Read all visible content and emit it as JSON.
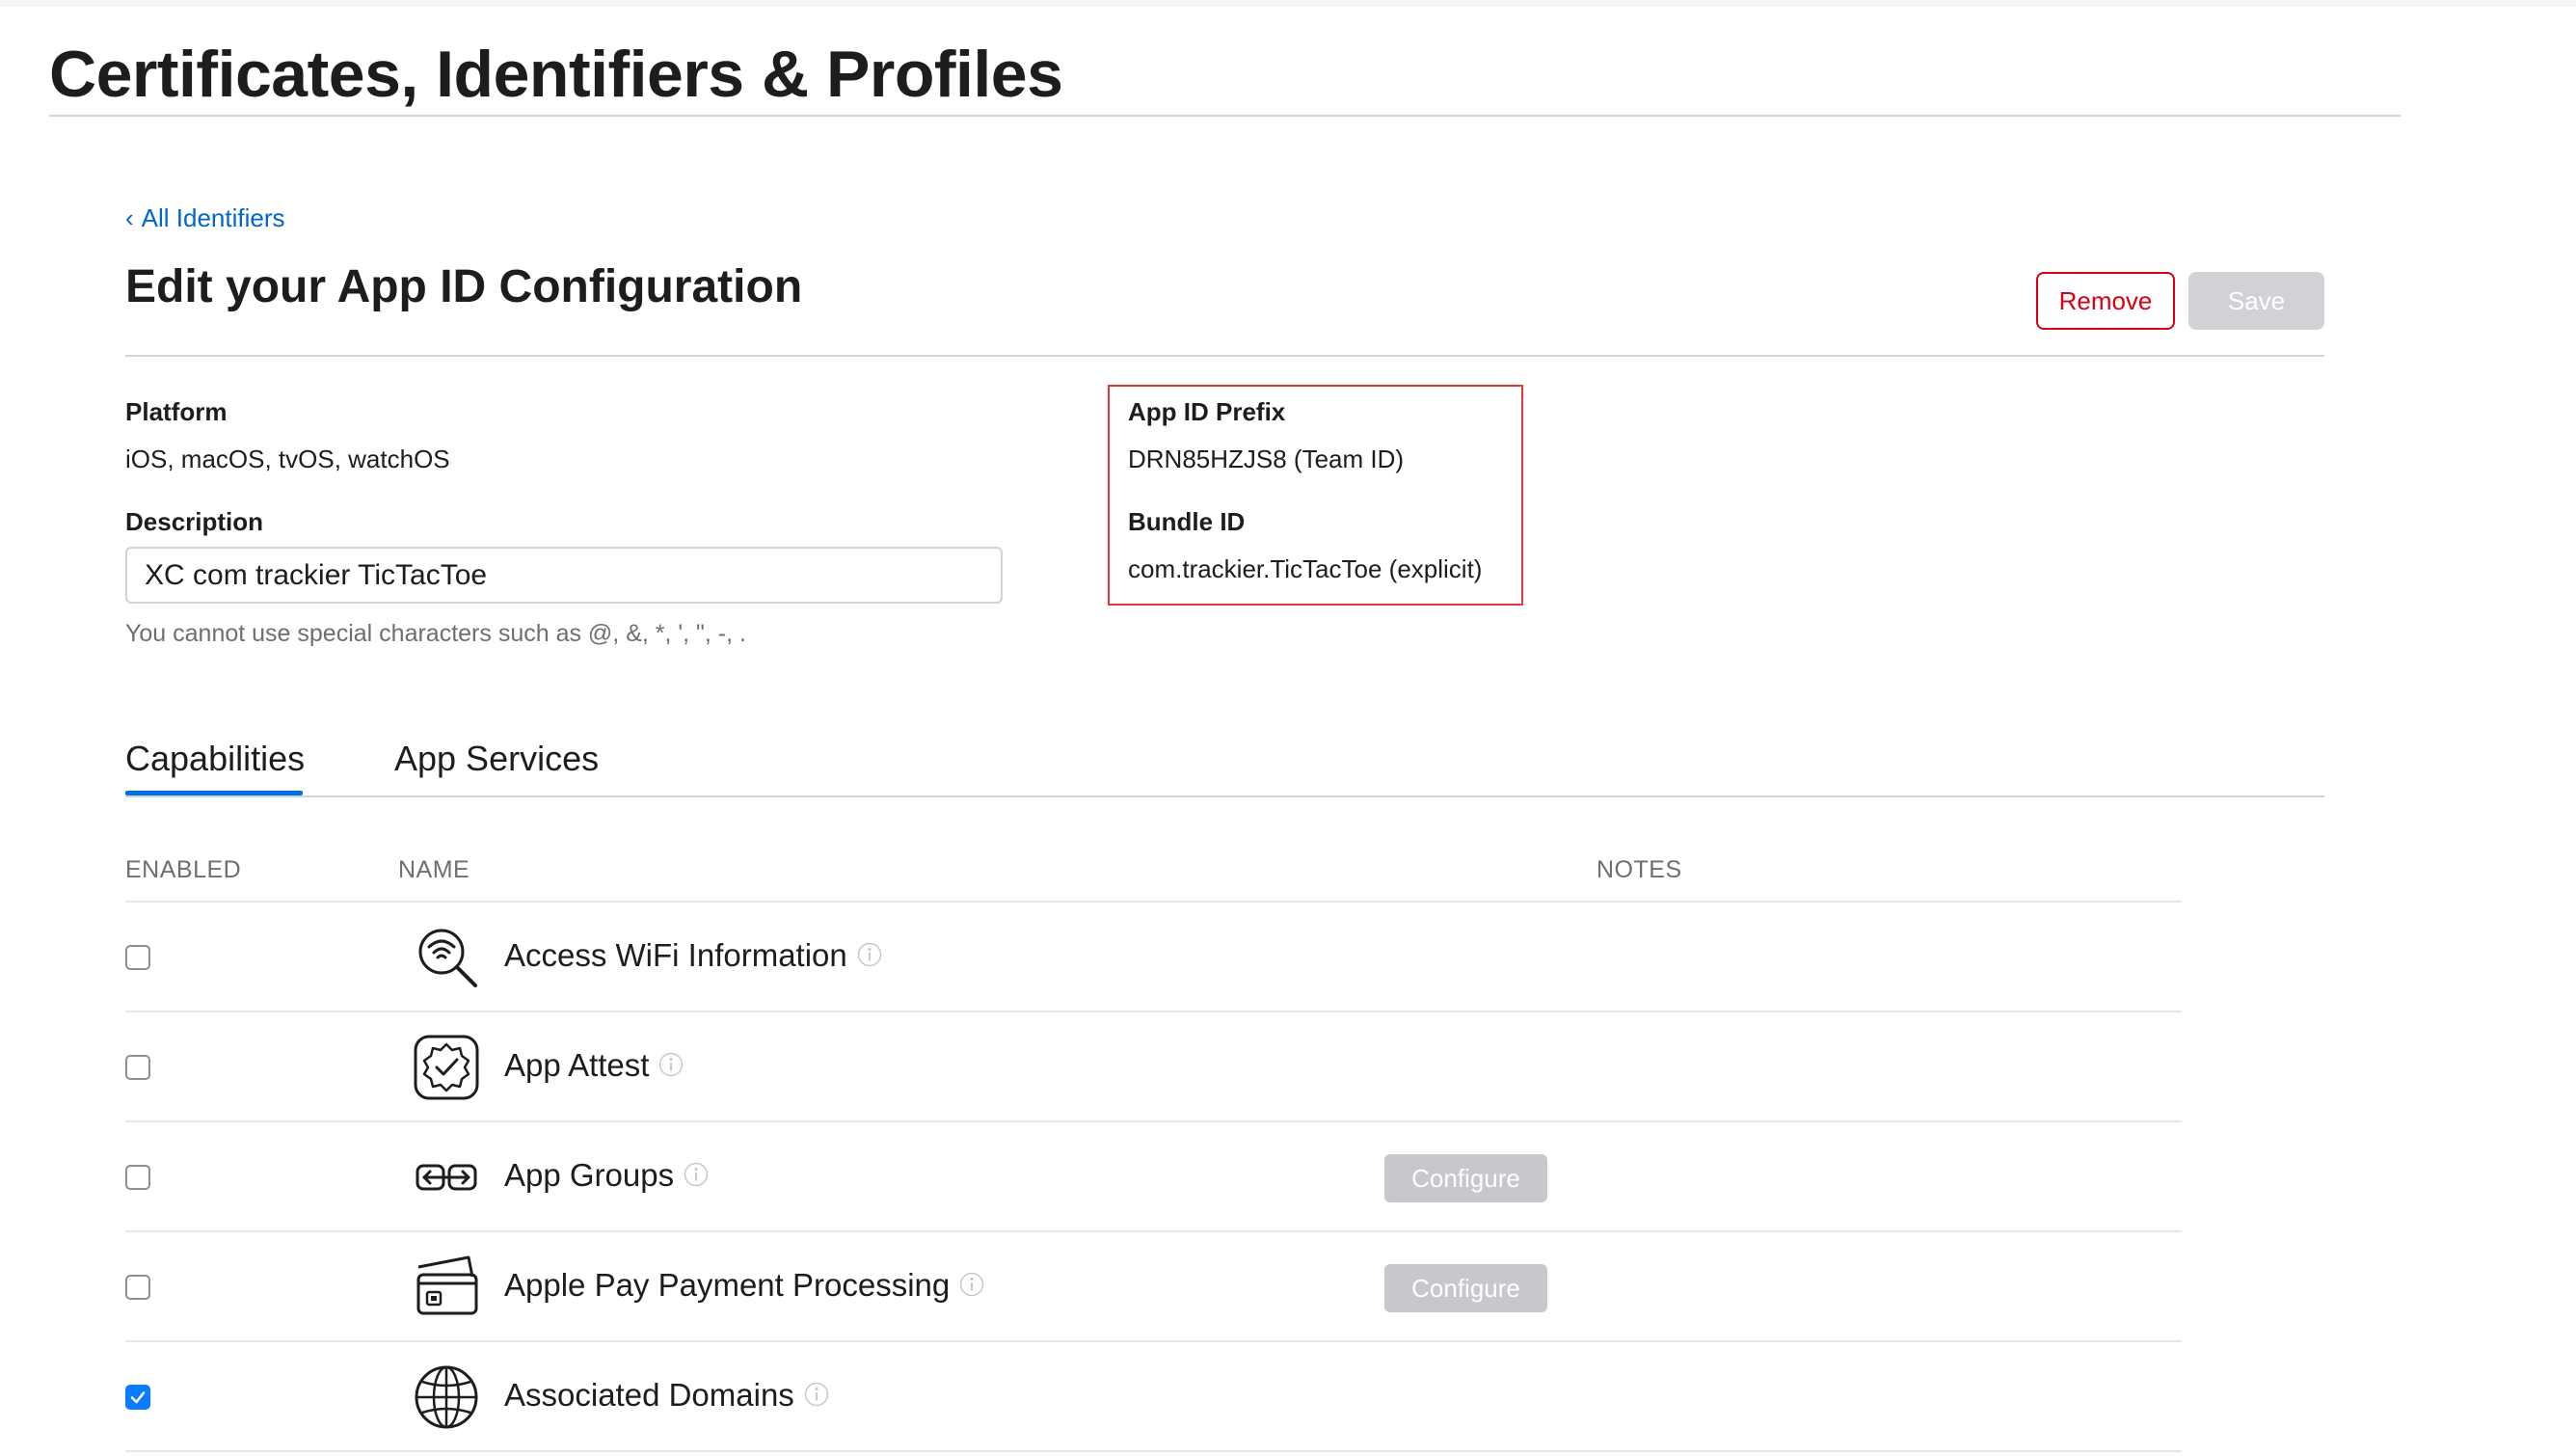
{
  "page": {
    "title": "Certificates, Identifiers & Profiles"
  },
  "breadcrumb": {
    "chevron": "‹",
    "label": "All Identifiers"
  },
  "section": {
    "title": "Edit your App ID Configuration"
  },
  "actions": {
    "remove_label": "Remove",
    "save_label": "Save",
    "remove_color": "#d70015",
    "save_disabled": true
  },
  "platform": {
    "label": "Platform",
    "value": "iOS, macOS, tvOS, watchOS"
  },
  "description": {
    "label": "Description",
    "value": "XC com trackier TicTacToe",
    "hint": "You cannot use special characters such as @, &, *, ', \", -, ."
  },
  "app_id_prefix": {
    "label": "App ID Prefix",
    "value": "DRN85HZJS8 (Team ID)"
  },
  "bundle_id": {
    "label": "Bundle ID",
    "value": "com.trackier.TicTacToe (explicit)"
  },
  "tabs": [
    {
      "label": "Capabilities",
      "active": true
    },
    {
      "label": "App Services",
      "active": false
    }
  ],
  "table": {
    "headers": {
      "enabled": "ENABLED",
      "name": "NAME",
      "notes": "NOTES"
    },
    "rows": [
      {
        "name": "Access WiFi Information",
        "icon": "wifi-search-icon",
        "enabled": false,
        "configure": null
      },
      {
        "name": "App Attest",
        "icon": "verified-badge-icon",
        "enabled": false,
        "configure": null
      },
      {
        "name": "App Groups",
        "icon": "app-groups-icon",
        "enabled": false,
        "configure": "Configure"
      },
      {
        "name": "Apple Pay Payment Processing",
        "icon": "payment-card-icon",
        "enabled": false,
        "configure": "Configure"
      },
      {
        "name": "Associated Domains",
        "icon": "globe-icon",
        "enabled": true,
        "configure": null
      }
    ]
  },
  "colors": {
    "accent": "#0071e3",
    "link": "#0066cc",
    "highlight_box": "#e0393e",
    "checkbox_checked": "#0a7cff"
  }
}
